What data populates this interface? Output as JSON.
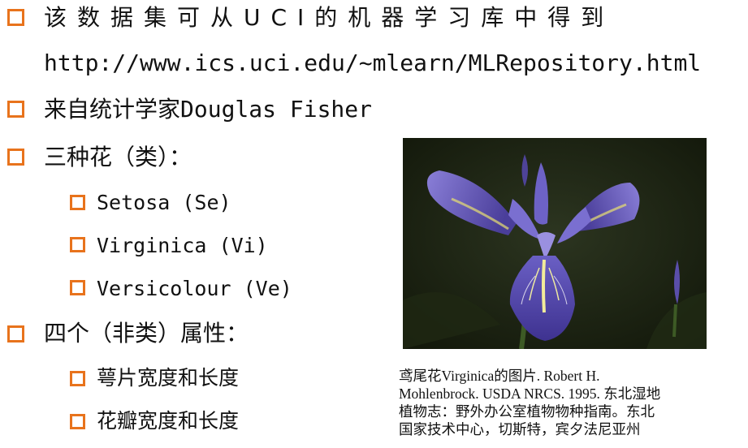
{
  "bullets": [
    {
      "text": "该数据集可从UCI的机器学习库中得到"
    },
    {
      "text": "http://www.ics.uci.edu/~mlearn/MLRepository.html"
    },
    {
      "text": "来自统计学家Douglas Fisher"
    },
    {
      "text": "三种花（类）："
    },
    {
      "text": "Setosa (Se)"
    },
    {
      "text": "Virginica (Vi)"
    },
    {
      "text": "Versicolour (Ve)"
    },
    {
      "text": "四个（非类）属性："
    },
    {
      "text": "萼片宽度和长度"
    },
    {
      "text": "花瓣宽度和长度"
    }
  ],
  "figure": {
    "caption_lines": [
      "鸢尾花Virginica的图片. Robert H.",
      "Mohlenbrock. USDA NRCS. 1995. 东北湿地",
      "植物志：野外办公室植物物种指南。东北",
      "国家技术中心，切斯特，宾夕法尼亚州"
    ]
  },
  "colors": {
    "bullet_accent": "#e8731c",
    "text": "#111111",
    "photo_background": "#1b2114",
    "petal": "#5b4fb0"
  }
}
